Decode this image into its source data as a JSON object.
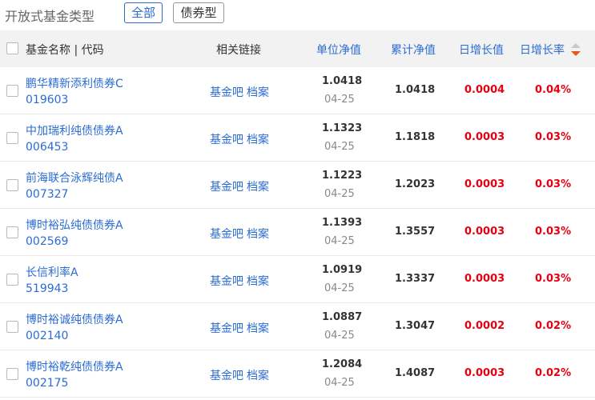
{
  "filter": {
    "title": "开放式基金类型",
    "buttons": [
      "全部",
      "债券型"
    ]
  },
  "table": {
    "headers": {
      "name": "基金名称 | 代码",
      "links": "相关链接",
      "nav": "单位净值",
      "acc_nav": "累计净值",
      "daily_inc": "日增长值",
      "daily_rate": "日增长率"
    },
    "link_labels": [
      "基金吧",
      "档案"
    ],
    "rows": [
      {
        "name": "鹏华精新添利债券C",
        "code": "019603",
        "nav": "1.0418",
        "date": "04-25",
        "acc_nav": "1.0418",
        "daily_inc": "0.0004",
        "daily_rate": "0.04%"
      },
      {
        "name": "中加瑞利纯债债券A",
        "code": "006453",
        "nav": "1.1323",
        "date": "04-25",
        "acc_nav": "1.1818",
        "daily_inc": "0.0003",
        "daily_rate": "0.03%"
      },
      {
        "name": "前海联合泳辉纯债A",
        "code": "007327",
        "nav": "1.1223",
        "date": "04-25",
        "acc_nav": "1.2023",
        "daily_inc": "0.0003",
        "daily_rate": "0.03%"
      },
      {
        "name": "博时裕弘纯债债券A",
        "code": "002569",
        "nav": "1.1393",
        "date": "04-25",
        "acc_nav": "1.3557",
        "daily_inc": "0.0003",
        "daily_rate": "0.03%"
      },
      {
        "name": "长信利率A",
        "code": "519943",
        "nav": "1.0919",
        "date": "04-25",
        "acc_nav": "1.3337",
        "daily_inc": "0.0003",
        "daily_rate": "0.03%"
      },
      {
        "name": "博时裕诚纯债债券A",
        "code": "002140",
        "nav": "1.0887",
        "date": "04-25",
        "acc_nav": "1.3047",
        "daily_inc": "0.0002",
        "daily_rate": "0.02%"
      },
      {
        "name": "博时裕乾纯债债券A",
        "code": "002175",
        "nav": "1.2084",
        "date": "04-25",
        "acc_nav": "1.4087",
        "daily_inc": "0.0003",
        "daily_rate": "0.02%"
      }
    ]
  },
  "colors": {
    "link_blue": "#2b6cd3",
    "up_red": "#e60012",
    "header_bg": "#f2f2f2"
  },
  "icons": {
    "sort": "sort-desc-icon"
  }
}
